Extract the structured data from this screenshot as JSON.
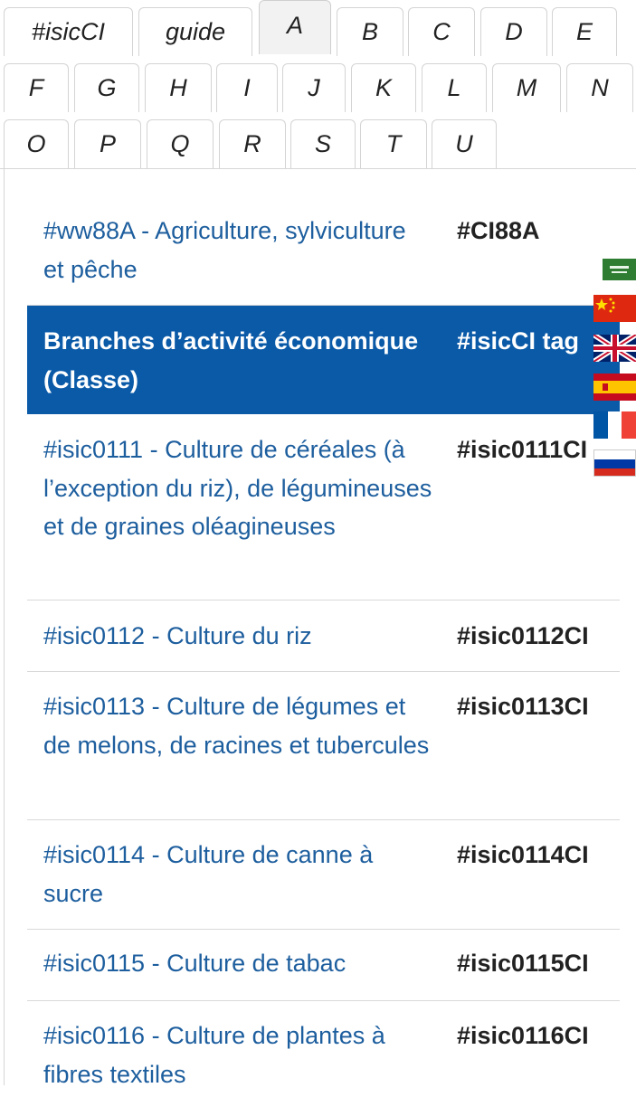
{
  "tabs": [
    "#isicCI",
    "guide",
    "A",
    "B",
    "C",
    "D",
    "E",
    "F",
    "G",
    "H",
    "I",
    "J",
    "K",
    "L",
    "M",
    "N",
    "O",
    "P",
    "Q",
    "R",
    "S",
    "T",
    "U"
  ],
  "active_tab": "A",
  "rows": [
    {
      "label": "#ww88A - Agriculture, sylviculture et pêche",
      "tag": "#CI88A"
    },
    {
      "label": "Branches d’activité économique (Classe)",
      "tag": "#isicCI tag",
      "header": true
    },
    {
      "label": "#isic0111 - Culture de céréales (à l’exception du riz), de légumineuses et de graines oléagineuses",
      "tag": "#isic0111CI"
    },
    {
      "label": "#isic0112 - Culture du riz",
      "tag": "#isic0112CI"
    },
    {
      "label": "#isic0113 - Culture de légumes et de melons, de racines et tubercules",
      "tag": "#isic0113CI"
    },
    {
      "label": "#isic0114 - Culture de canne à sucre",
      "tag": "#isic0114CI"
    },
    {
      "label": "#isic0115 - Culture de tabac",
      "tag": "#isic0115CI"
    },
    {
      "label": "#isic0116 - Culture de plantes à fibres textiles",
      "tag": "#isic0116CI"
    }
  ],
  "languages": [
    "saudi-arabia-flag-icon",
    "china-flag-icon",
    "uk-flag-icon",
    "spain-flag-icon",
    "france-flag-icon",
    "russia-flag-icon"
  ],
  "colors": {
    "link": "#1d5e9e",
    "header_bg": "#0a5aa8",
    "tag": "#222222"
  }
}
